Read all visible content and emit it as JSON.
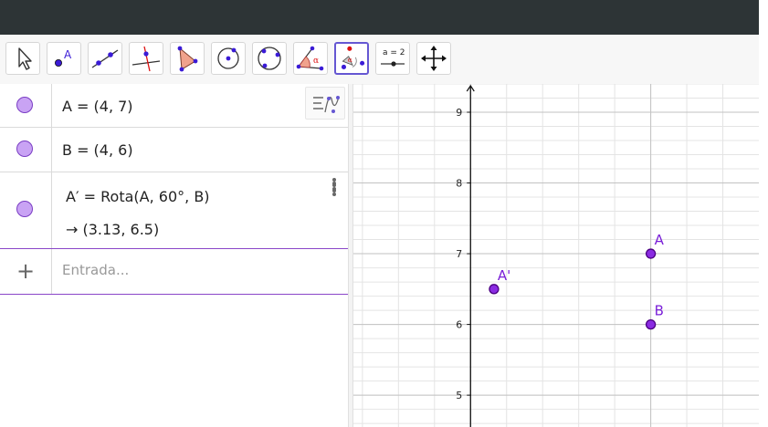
{
  "toolbar": {
    "tools": [
      {
        "name": "move-tool-icon"
      },
      {
        "name": "point-tool-icon",
        "label": "A"
      },
      {
        "name": "line-tool-icon"
      },
      {
        "name": "perpendicular-line-tool-icon"
      },
      {
        "name": "polygon-tool-icon"
      },
      {
        "name": "circle-center-point-tool-icon"
      },
      {
        "name": "circle-three-points-tool-icon"
      },
      {
        "name": "angle-tool-icon",
        "label": "α"
      },
      {
        "name": "rotate-around-point-tool-icon",
        "active": true
      },
      {
        "name": "slider-tool-icon",
        "label": "a = 2"
      },
      {
        "name": "move-graphics-view-tool-icon"
      }
    ]
  },
  "algebra": {
    "rows": [
      {
        "expr": "A = (4, 7)"
      },
      {
        "expr": "B = (4, 6)"
      },
      {
        "expr": "A′ = Rota(A, 60°, B)",
        "result": "→  (3.13, 6.5)"
      }
    ],
    "input": {
      "placeholder": "Entrada..."
    }
  },
  "graphics": {
    "x_axis": {
      "min": 2.35,
      "max": 4.6
    },
    "y_axis": {
      "min": 4.55,
      "max": 9.4,
      "ticks": [
        "5",
        "6",
        "7",
        "8",
        "9"
      ]
    },
    "points": [
      {
        "label": "A",
        "x": 4,
        "y": 7
      },
      {
        "label": "B",
        "x": 4,
        "y": 6
      },
      {
        "label": "A'",
        "x": 3.13,
        "y": 6.5
      }
    ],
    "colors": {
      "point_fill": "#8a2be2",
      "point_stroke": "#4b0082",
      "label": "#7a1fd8",
      "marble": "#c9a3f4",
      "active_tool": "#6557d2"
    }
  }
}
